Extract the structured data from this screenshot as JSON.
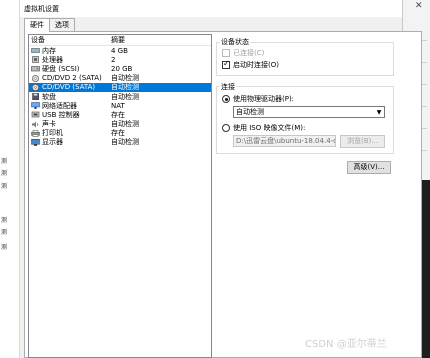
{
  "window": {
    "title": "虚拟机设置"
  },
  "tabs": [
    {
      "label": "硬件"
    },
    {
      "label": "选项"
    }
  ],
  "device_list": {
    "headers": {
      "device": "设备",
      "summary": "摘要"
    },
    "rows": [
      {
        "icon": "memory-icon",
        "name": "内存",
        "summary": "4 GB"
      },
      {
        "icon": "processor-icon",
        "name": "处理器",
        "summary": "2"
      },
      {
        "icon": "harddisk-icon",
        "name": "硬盘 (SCSI)",
        "summary": "20 GB"
      },
      {
        "icon": "cd-dvd-icon",
        "name": "CD/DVD 2 (SATA)",
        "summary": "自动检测"
      },
      {
        "icon": "cd-dvd-icon",
        "name": "CD/DVD (SATA)",
        "summary": "自动检测"
      },
      {
        "icon": "floppy-icon",
        "name": "软盘",
        "summary": "自动检测"
      },
      {
        "icon": "network-adapter-icon",
        "name": "网络适配器",
        "summary": "NAT"
      },
      {
        "icon": "usb-controller-icon",
        "name": "USB 控制器",
        "summary": "存在"
      },
      {
        "icon": "sound-card-icon",
        "name": "声卡",
        "summary": "自动检测"
      },
      {
        "icon": "printer-icon",
        "name": "打印机",
        "summary": "存在"
      },
      {
        "icon": "display-icon",
        "name": "显示器",
        "summary": "自动检测"
      }
    ],
    "selected_index": 4
  },
  "device_status": {
    "title": "设备状态",
    "connected": {
      "label": "已连接(C)",
      "checked": false,
      "enabled": false
    },
    "connect_at_power_on": {
      "label": "启动时连接(O)",
      "checked": true,
      "enabled": true
    }
  },
  "connection": {
    "title": "连接",
    "physical": {
      "label": "使用物理驱动器(P):",
      "selected": true,
      "drive_value": "自动检测"
    },
    "iso": {
      "label": "使用 ISO 映像文件(M):",
      "selected": false,
      "path_value": "D:\\迅雷云盘\\ubuntu-18.04.4-d",
      "browse_label": "浏览(B)..."
    }
  },
  "advanced_button": {
    "label": "高级(V)..."
  },
  "background": {
    "left_fragments": [
      "测",
      "测",
      "测",
      "测",
      "测",
      "测"
    ]
  },
  "watermark": "CSDN @亚尔蒂兰"
}
